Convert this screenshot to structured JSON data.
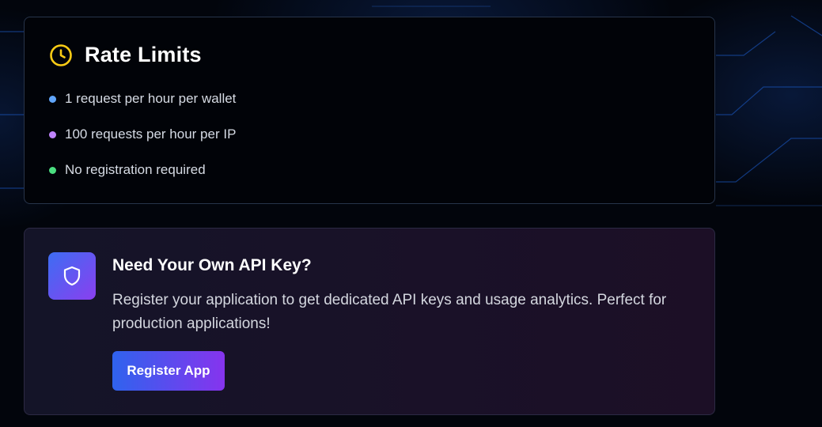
{
  "rate_limits": {
    "icon": "clock-icon",
    "title": "Rate Limits",
    "items": [
      {
        "text": "1 request per hour per wallet",
        "dot_color": "#60a5fa"
      },
      {
        "text": "100 requests per hour per IP",
        "dot_color": "#c084fc"
      },
      {
        "text": "No registration required",
        "dot_color": "#4ade80"
      }
    ]
  },
  "api_key": {
    "icon": "shield-icon",
    "title": "Need Your Own API Key?",
    "description": "Register your application to get dedicated API keys and usage analytics. Perfect for production applications!",
    "button_label": "Register App"
  },
  "colors": {
    "accent_yellow": "#facc15",
    "gradient_start": "#2f63ee",
    "gradient_end": "#8634ee"
  }
}
